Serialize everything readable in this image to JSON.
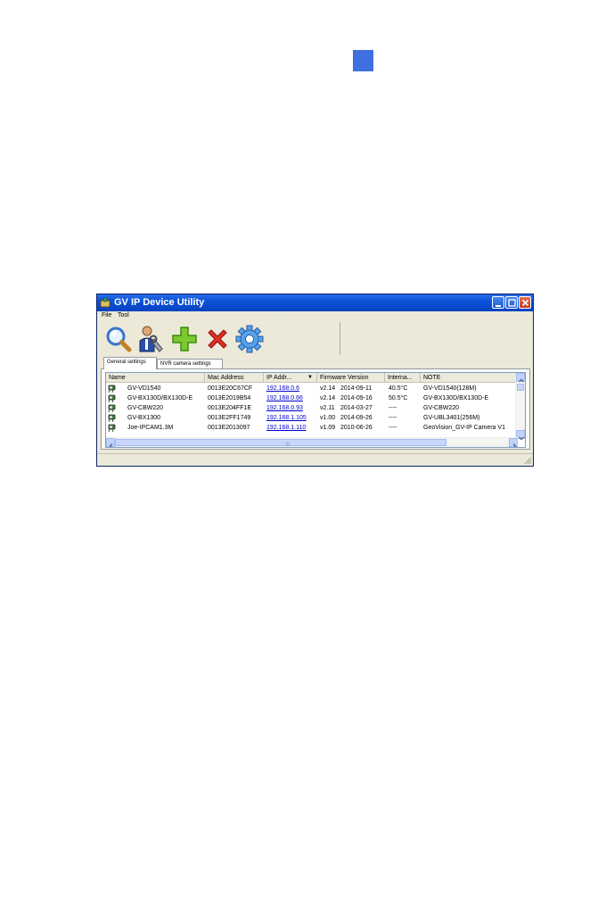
{
  "window": {
    "title": "GV IP Device Utility",
    "menu": [
      "File",
      "Tool"
    ],
    "toolbar": [
      "search-icon",
      "user-settings-icon",
      "add-icon",
      "delete-icon",
      "settings-gear-icon"
    ],
    "tabs": [
      "General settings",
      "NVR camera settings"
    ],
    "active_tab": "General settings"
  },
  "table": {
    "columns": [
      "Name",
      "Mac Address",
      "IP Addr...",
      "Firmware Version",
      "Interna...",
      "NOTE"
    ],
    "sort_column": "IP Addr...",
    "rows": [
      {
        "name": "GV-VD1540",
        "mac": "0013E20C67CF",
        "ip": "192.168.0.6",
        "fw_ver": "v2.14",
        "fw_date": "2014-09-11",
        "temp": "40.5°C",
        "note": "GV-VD1540(128M)"
      },
      {
        "name": "GV-BX130D/BX130D-E",
        "mac": "0013E2019B54",
        "ip": "192.168.0.66",
        "fw_ver": "v2.14",
        "fw_date": "2014-09-16",
        "temp": "50.5°C",
        "note": "GV-BX130D/BX130D-E"
      },
      {
        "name": "GV-CBW220",
        "mac": "0013E204FF1E",
        "ip": "192.168.0.93",
        "fw_ver": "v2.11",
        "fw_date": "2014-03-27",
        "temp": "----",
        "note": "GV-CBW220"
      },
      {
        "name": "GV-BX1300",
        "mac": "0013E2FF1749",
        "ip": "192.168.1.105",
        "fw_ver": "v1.00",
        "fw_date": "2014-09-26",
        "temp": "----",
        "note": "GV-UBL3401(256M)"
      },
      {
        "name": "Joe-IPCAM1.3M",
        "mac": "0013E2013097",
        "ip": "192.168.1.110",
        "fw_ver": "v1.09",
        "fw_date": "2010-06-26",
        "temp": "----",
        "note": "GeoVision_GV-IP Camera V1"
      }
    ]
  },
  "colors": {
    "titlebar": "#0a52d8",
    "page_tab": "#3f6fe0",
    "link": "#0000cc"
  }
}
